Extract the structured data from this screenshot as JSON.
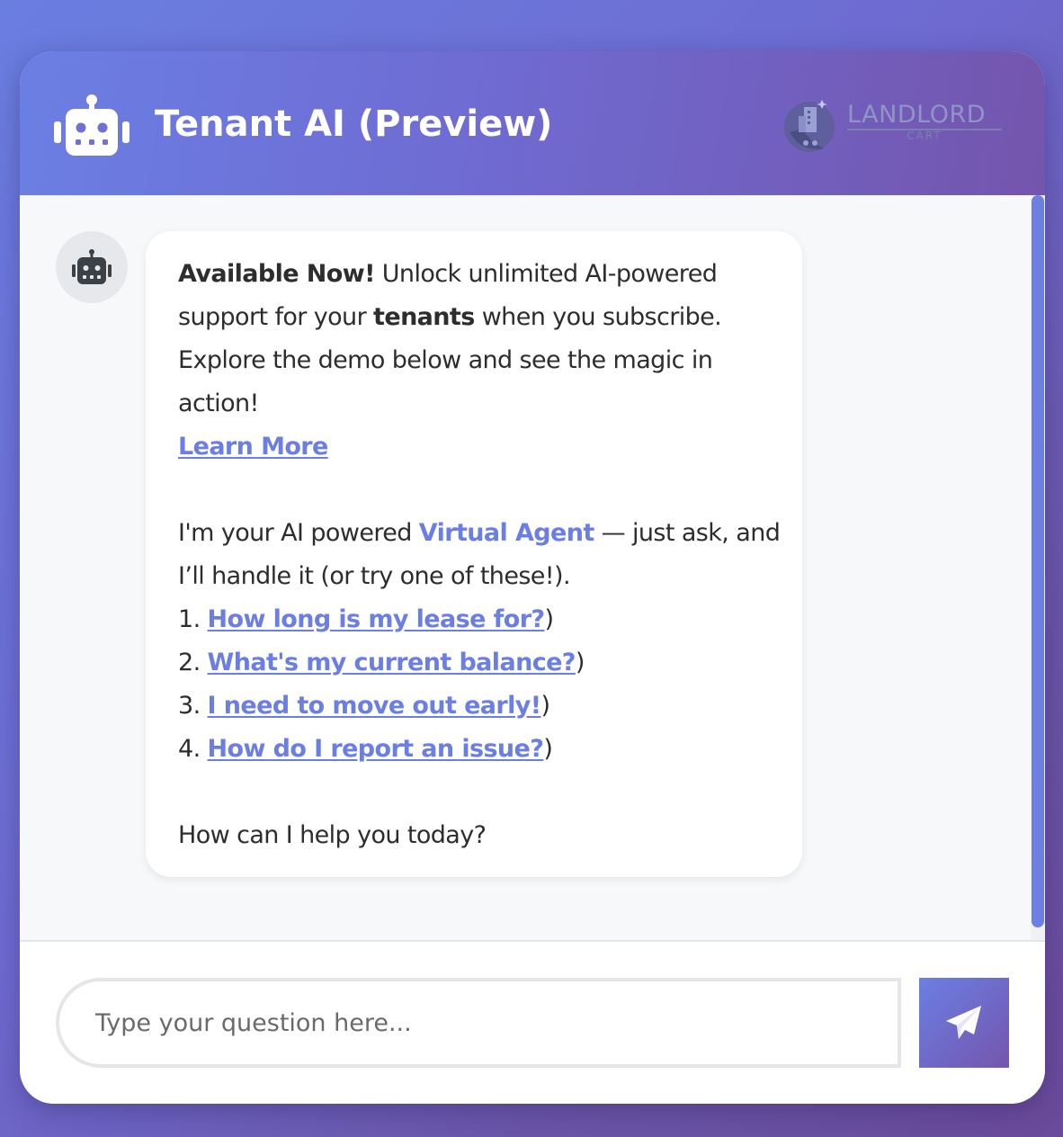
{
  "header": {
    "title": "Tenant AI (Preview)",
    "icon": "robot-icon",
    "logo": {
      "name": "LANDLORD",
      "sub": "CART"
    }
  },
  "message": {
    "avatar_icon": "robot-icon",
    "line1_bold": "Available Now!",
    "line1_rest": " Unlock unlimited AI-powered support for your ",
    "tenants_bold": "tenants",
    "line1_end": " when you subscribe. Explore the demo below and see the magic in action!",
    "learn_more": "Learn More",
    "intro_start": "I'm your AI powered ",
    "virtual_agent": "Virtual Agent",
    "intro_end": " — just ask, and I’ll handle it (or try one of these!).",
    "suggestions": [
      {
        "num": "1.",
        "label": "How long is my lease for?",
        "close": ")"
      },
      {
        "num": "2.",
        "label": "What's my current balance?",
        "close": ")"
      },
      {
        "num": "3.",
        "label": "I need to move out early!",
        "close": ")"
      },
      {
        "num": "4.",
        "label": "How do I report an issue?",
        "close": ")"
      }
    ],
    "closing": "How can I help you today?"
  },
  "input": {
    "placeholder": "Type your question here...",
    "value": ""
  },
  "send_button": {
    "icon": "paper-plane-icon"
  },
  "colors": {
    "accent": "#6b7ee2",
    "header_start": "#6b7fe3",
    "header_end": "#7455ad"
  }
}
